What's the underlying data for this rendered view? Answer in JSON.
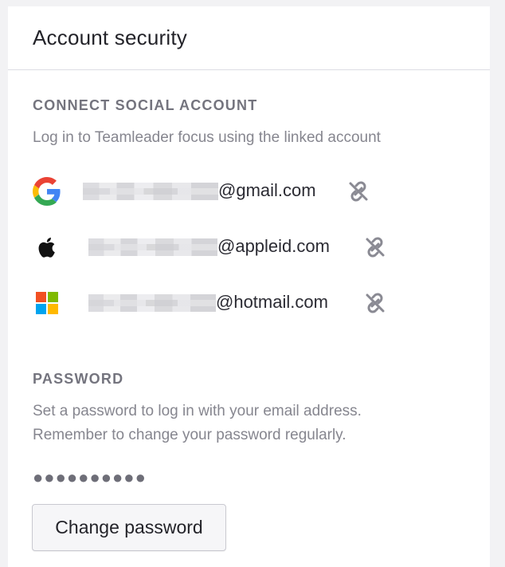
{
  "card": {
    "title": "Account security"
  },
  "social": {
    "heading": "CONNECT SOCIAL ACCOUNT",
    "description": "Log in to Teamleader focus using the linked account",
    "accounts": [
      {
        "provider_icon": "google-icon",
        "domain": "@gmail.com",
        "action_icon": "unlink-icon"
      },
      {
        "provider_icon": "apple-icon",
        "domain": "@appleid.com",
        "action_icon": "unlink-icon"
      },
      {
        "provider_icon": "microsoft-icon",
        "domain": "@hotmail.com",
        "action_icon": "unlink-icon"
      }
    ]
  },
  "password": {
    "heading": "PASSWORD",
    "description_line1": "Set a password to log in with your email address.",
    "description_line2": "Remember to change your password regularly.",
    "masked_value": "●●●●●●●●●●",
    "change_button_label": "Change password"
  },
  "colors": {
    "google_blue": "#4285F4",
    "google_red": "#EA4335",
    "google_yellow": "#FBBC05",
    "google_green": "#34A853",
    "ms_red": "#F25022",
    "ms_green": "#7FBA00",
    "ms_blue": "#00A4EF",
    "ms_yellow": "#FFB900",
    "muted_text": "#86868f",
    "heading_text": "#74747e"
  }
}
